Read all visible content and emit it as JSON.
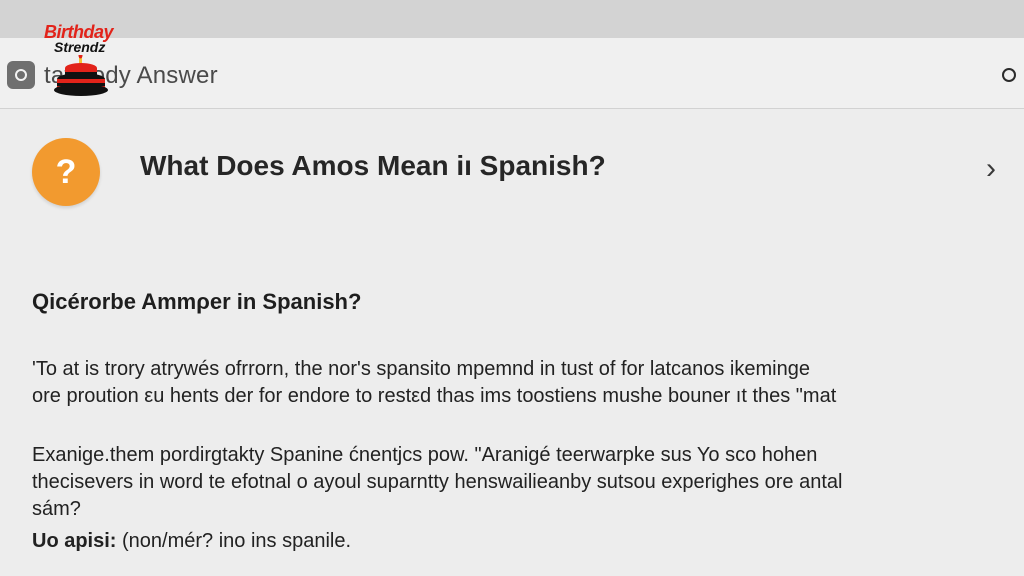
{
  "toolbar": {
    "app_name": "tattoody Answer",
    "app_icon": "circle-app-icon",
    "menu_icon": "circle-icon"
  },
  "logo": {
    "line1": "Birthday",
    "line2": "Strendz",
    "icon": "cake-icon",
    "colors": {
      "red": "#e2231a",
      "black": "#111111"
    }
  },
  "question": {
    "badge": "?",
    "title": "What Does Amos Mean iı Spanish?",
    "chevron": "›",
    "badge_color": "#f29a2f"
  },
  "content": {
    "heading": "Qicérorbe Ammρer in Spanish?",
    "paragraph1": [
      "'To at is trory atrywés ofrrorn, the nor's spansito mpemnd in tust of for latcanos ikeminge",
      "ore proution εu hents der for endore to restεd thas ims toostiens mushe bouner ıt thes \"mat"
    ],
    "paragraph2": [
      "Exanige.them pordirgtakty Spanine ćnentjcs pow. \"Aranigé teerwarpke sus Yo sco hohen",
      "thecisevers in word te efotnal o ayoul suparntty henswailieanby sutsou experighes ore antal",
      "sám?"
    ],
    "paragraph3_label": "Uo apisi:",
    "paragraph3_text": "(non/mér? ino ins spanile."
  }
}
